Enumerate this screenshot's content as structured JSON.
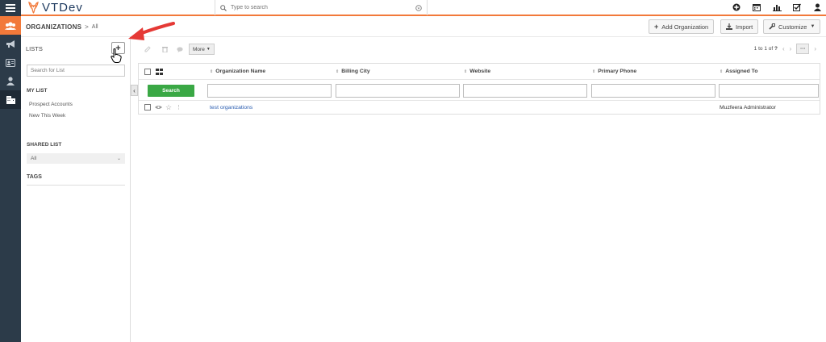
{
  "app": {
    "title": "VTDev"
  },
  "topbar": {
    "search_placeholder": "Type to search",
    "icons": [
      "plus-circle-icon",
      "calendar-icon",
      "chart-icon",
      "checkbox-icon",
      "user-icon"
    ]
  },
  "breadcrumb": {
    "module": "ORGANIZATIONS",
    "separator": ">",
    "current": "All"
  },
  "header_actions": {
    "add": "Add Organization",
    "import": "Import",
    "customize": "Customize"
  },
  "lists": {
    "title": "LISTS",
    "add_label": "+",
    "search_placeholder": "Search for List",
    "my_list_heading": "MY LIST",
    "my_list": [
      "Prospect Accounts",
      "New This Week"
    ],
    "shared_heading": "SHARED LIST",
    "shared_selected": "All",
    "tags_heading": "TAGS"
  },
  "toolbar": {
    "more": "More"
  },
  "pagination": {
    "from": "1",
    "to_label": "to",
    "to": "1",
    "of_label": "of",
    "total": "?"
  },
  "table": {
    "columns": [
      "Organization Name",
      "Billing City",
      "Website",
      "Primary Phone",
      "Assigned To"
    ],
    "search_button": "Search",
    "rows": [
      {
        "name": "test organizations",
        "assigned": "Muzfeera Administrator"
      }
    ]
  },
  "colors": {
    "accent": "#f2793a",
    "rail": "#2c3b49",
    "search_button": "#3aa845",
    "annotation": "#e53935"
  }
}
